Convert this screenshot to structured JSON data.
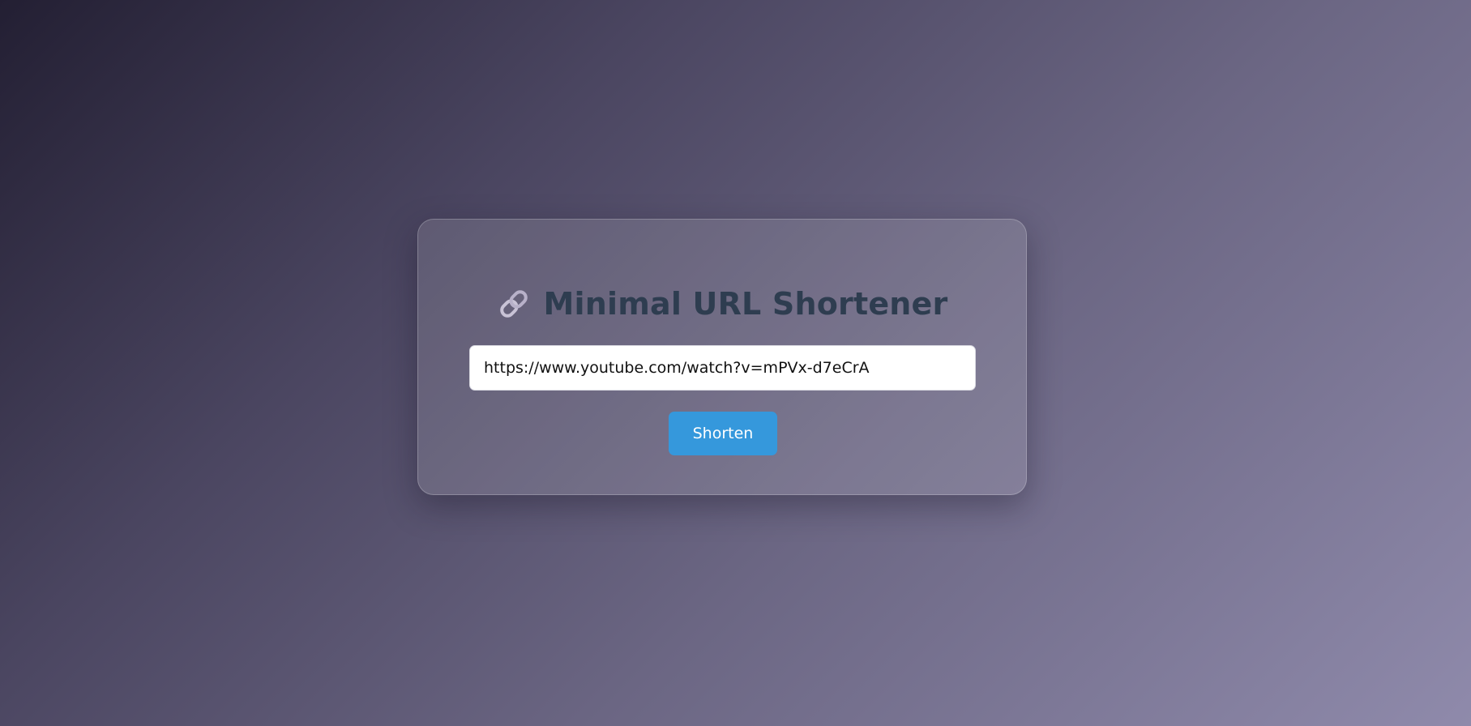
{
  "app": {
    "title": "Minimal URL Shortener",
    "title_icon": "link-icon"
  },
  "form": {
    "url_value": "https://www.youtube.com/watch?v=mPVx-d7eCrA",
    "shorten_label": "Shorten"
  },
  "colors": {
    "accent": "#3598dc",
    "title_text": "#2e3d50",
    "background_start": "#231f33",
    "background_end": "#8f8aab"
  }
}
